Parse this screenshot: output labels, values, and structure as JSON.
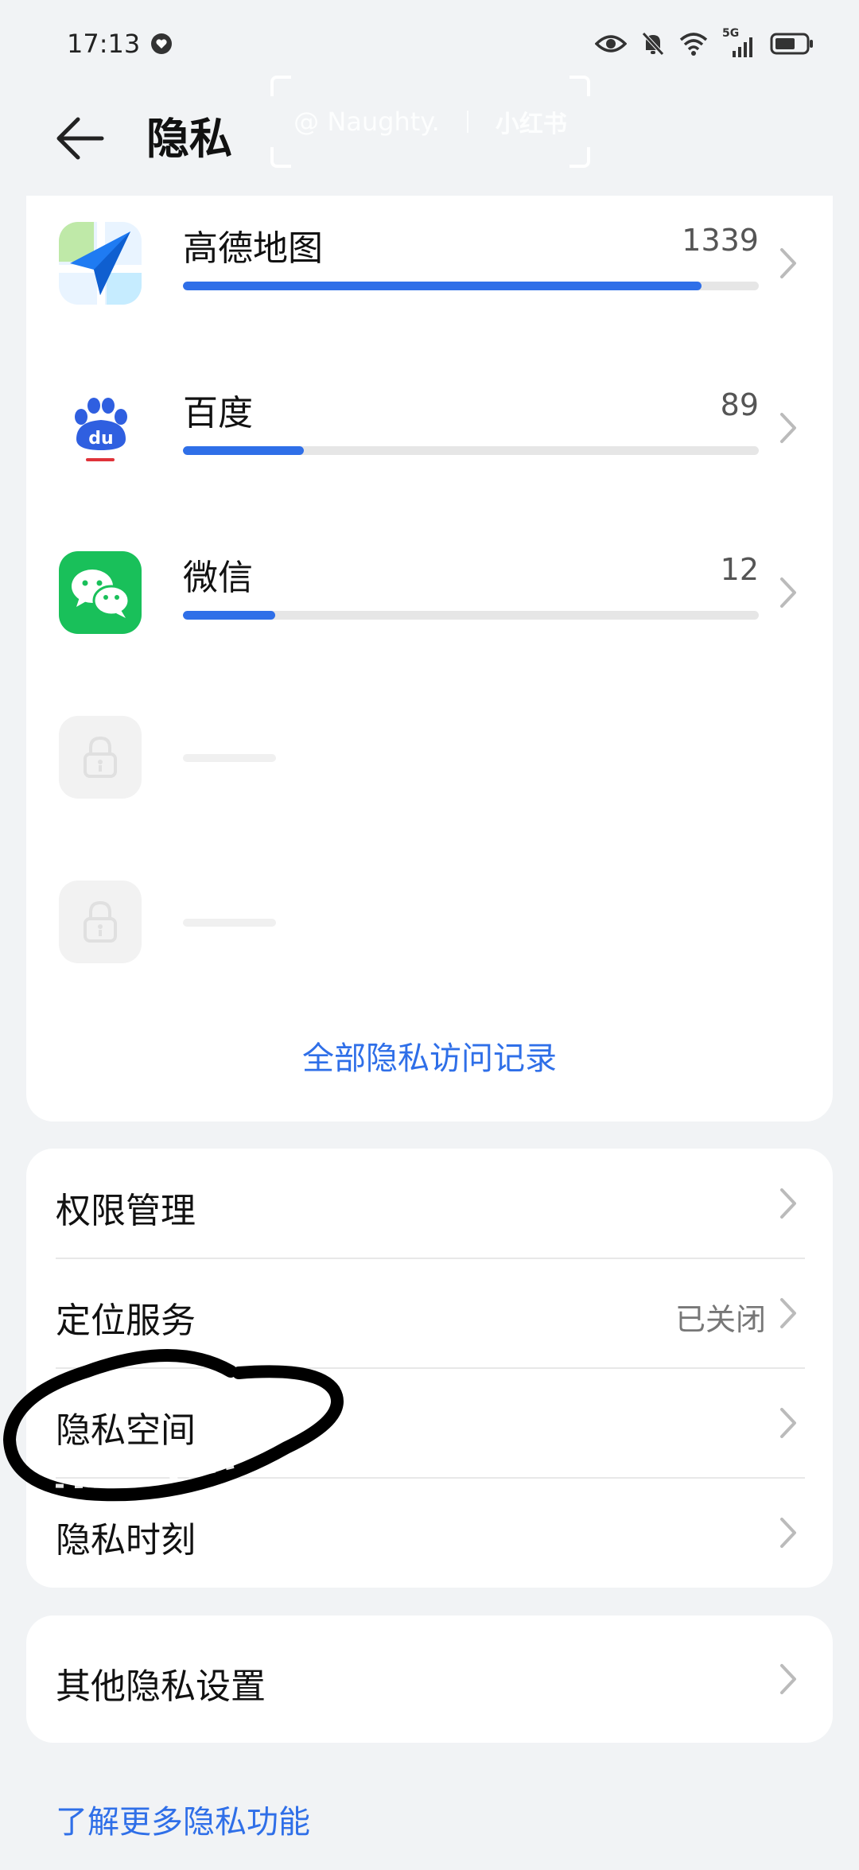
{
  "status_bar": {
    "time": "17:13",
    "network_label": "5G"
  },
  "header": {
    "title": "隐私",
    "watermark_user": "@ Naughty.",
    "watermark_brand": "小红书"
  },
  "apps": [
    {
      "name": "高德地图",
      "count": "1339",
      "progress": 0.9,
      "icon": "amap-icon"
    },
    {
      "name": "百度",
      "count": "89",
      "progress": 0.21,
      "icon": "baidu-icon"
    },
    {
      "name": "微信",
      "count": "12",
      "progress": 0.16,
      "icon": "wechat-icon"
    }
  ],
  "all_records_link": "全部隐私访问记录",
  "settings_list": {
    "permission_management": "权限管理",
    "location_service": "定位服务",
    "location_service_value": "已关闭",
    "private_space": "隐私空间",
    "privacy_moment": "隐私时刻"
  },
  "other_settings": "其他隐私设置",
  "learn_more": "了解更多隐私功能",
  "colors": {
    "accent": "#2f6fe8",
    "background": "#f1f3f5",
    "card": "#ffffff"
  }
}
